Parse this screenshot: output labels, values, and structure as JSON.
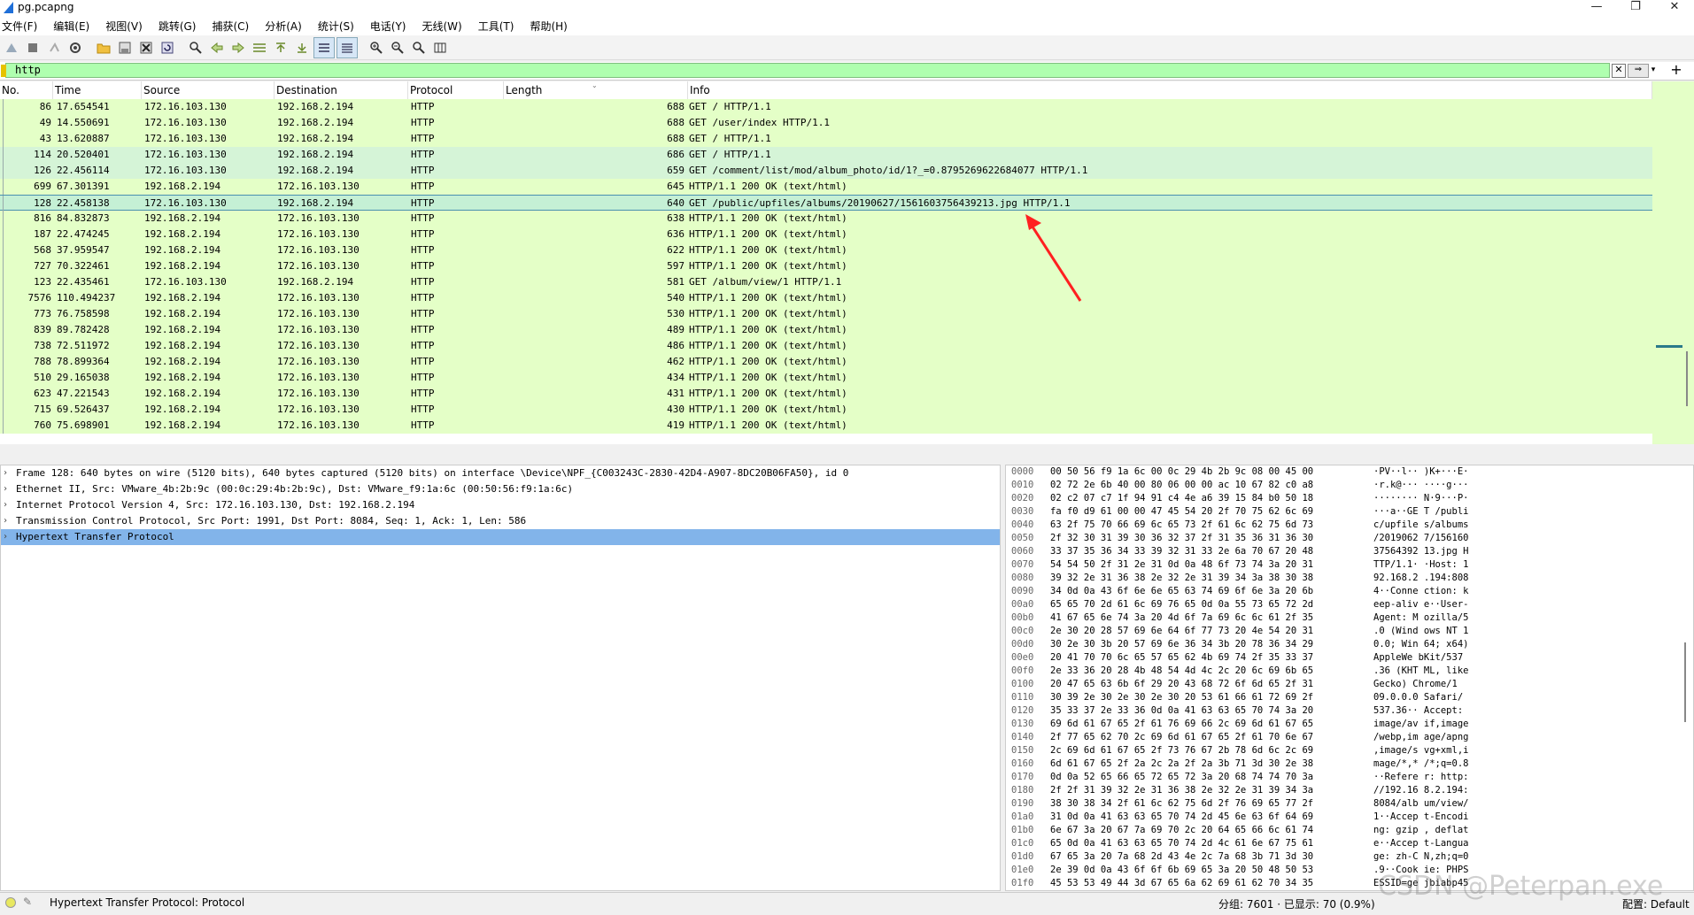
{
  "window": {
    "title": "pg.pcapng",
    "minimize": "—",
    "maximize": "❐",
    "close": "✕"
  },
  "menu": [
    "文件(F)",
    "编辑(E)",
    "视图(V)",
    "跳转(G)",
    "捕获(C)",
    "分析(A)",
    "统计(S)",
    "电话(Y)",
    "无线(W)",
    "工具(T)",
    "帮助(H)"
  ],
  "toolbar": {
    "icons": [
      "start-capture-icon",
      "stop-capture-icon",
      "restart-capture-icon",
      "capture-options-icon",
      "open-file-icon",
      "save-file-icon",
      "close-file-icon",
      "reload-icon",
      "find-packet-icon",
      "go-back-icon",
      "go-forward-icon",
      "go-to-packet-icon",
      "go-first-icon",
      "go-last-icon",
      "autoscroll-icon",
      "colorize-icon",
      "zoom-in-icon",
      "zoom-out-icon",
      "zoom-normal-icon",
      "resize-columns-icon"
    ]
  },
  "filter": {
    "value": "http",
    "clear": "✕",
    "apply": "⇒",
    "dropdown": "▾",
    "add": "+"
  },
  "packet_list": {
    "columns": [
      "No.",
      "Time",
      "Source",
      "Destination",
      "Protocol",
      "Length",
      "Info"
    ],
    "rows": [
      {
        "no": "86",
        "time": "17.654541",
        "src": "172.16.103.130",
        "dst": "192.168.2.194",
        "proto": "HTTP",
        "len": "688",
        "info": "GET / HTTP/1.1"
      },
      {
        "no": "49",
        "time": "14.550691",
        "src": "172.16.103.130",
        "dst": "192.168.2.194",
        "proto": "HTTP",
        "len": "688",
        "info": "GET /user/index HTTP/1.1"
      },
      {
        "no": "43",
        "time": "13.620887",
        "src": "172.16.103.130",
        "dst": "192.168.2.194",
        "proto": "HTTP",
        "len": "688",
        "info": "GET / HTTP/1.1"
      },
      {
        "no": "114",
        "time": "20.520401",
        "src": "172.16.103.130",
        "dst": "192.168.2.194",
        "proto": "HTTP",
        "len": "686",
        "info": "GET / HTTP/1.1"
      },
      {
        "no": "126",
        "time": "22.456114",
        "src": "172.16.103.130",
        "dst": "192.168.2.194",
        "proto": "HTTP",
        "len": "659",
        "info": "GET /comment/list/mod/album_photo/id/1?_=0.8795269622684077 HTTP/1.1"
      },
      {
        "no": "699",
        "time": "67.301391",
        "src": "192.168.2.194",
        "dst": "172.16.103.130",
        "proto": "HTTP",
        "len": "645",
        "info": "HTTP/1.1 200 OK  (text/html)"
      },
      {
        "no": "128",
        "time": "22.458138",
        "src": "172.16.103.130",
        "dst": "192.168.2.194",
        "proto": "HTTP",
        "len": "640",
        "info": "GET /public/upfiles/albums/20190627/1561603756439213.jpg HTTP/1.1"
      },
      {
        "no": "816",
        "time": "84.832873",
        "src": "192.168.2.194",
        "dst": "172.16.103.130",
        "proto": "HTTP",
        "len": "638",
        "info": "HTTP/1.1 200 OK  (text/html)"
      },
      {
        "no": "187",
        "time": "22.474245",
        "src": "192.168.2.194",
        "dst": "172.16.103.130",
        "proto": "HTTP",
        "len": "636",
        "info": "HTTP/1.1 200 OK  (text/html)"
      },
      {
        "no": "568",
        "time": "37.959547",
        "src": "192.168.2.194",
        "dst": "172.16.103.130",
        "proto": "HTTP",
        "len": "622",
        "info": "HTTP/1.1 200 OK  (text/html)"
      },
      {
        "no": "727",
        "time": "70.322461",
        "src": "192.168.2.194",
        "dst": "172.16.103.130",
        "proto": "HTTP",
        "len": "597",
        "info": "HTTP/1.1 200 OK  (text/html)"
      },
      {
        "no": "123",
        "time": "22.435461",
        "src": "172.16.103.130",
        "dst": "192.168.2.194",
        "proto": "HTTP",
        "len": "581",
        "info": "GET /album/view/1 HTTP/1.1"
      },
      {
        "no": "7576",
        "time": "110.494237",
        "src": "192.168.2.194",
        "dst": "172.16.103.130",
        "proto": "HTTP",
        "len": "540",
        "info": "HTTP/1.1 200 OK  (text/html)"
      },
      {
        "no": "773",
        "time": "76.758598",
        "src": "192.168.2.194",
        "dst": "172.16.103.130",
        "proto": "HTTP",
        "len": "530",
        "info": "HTTP/1.1 200 OK  (text/html)"
      },
      {
        "no": "839",
        "time": "89.782428",
        "src": "192.168.2.194",
        "dst": "172.16.103.130",
        "proto": "HTTP",
        "len": "489",
        "info": "HTTP/1.1 200 OK  (text/html)"
      },
      {
        "no": "738",
        "time": "72.511972",
        "src": "192.168.2.194",
        "dst": "172.16.103.130",
        "proto": "HTTP",
        "len": "486",
        "info": "HTTP/1.1 200 OK  (text/html)"
      },
      {
        "no": "788",
        "time": "78.899364",
        "src": "192.168.2.194",
        "dst": "172.16.103.130",
        "proto": "HTTP",
        "len": "462",
        "info": "HTTP/1.1 200 OK  (text/html)"
      },
      {
        "no": "510",
        "time": "29.165038",
        "src": "192.168.2.194",
        "dst": "172.16.103.130",
        "proto": "HTTP",
        "len": "434",
        "info": "HTTP/1.1 200 OK  (text/html)"
      },
      {
        "no": "623",
        "time": "47.221543",
        "src": "192.168.2.194",
        "dst": "172.16.103.130",
        "proto": "HTTP",
        "len": "431",
        "info": "HTTP/1.1 200 OK  (text/html)"
      },
      {
        "no": "715",
        "time": "69.526437",
        "src": "192.168.2.194",
        "dst": "172.16.103.130",
        "proto": "HTTP",
        "len": "430",
        "info": "HTTP/1.1 200 OK  (text/html)"
      },
      {
        "no": "760",
        "time": "75.698901",
        "src": "192.168.2.194",
        "dst": "172.16.103.130",
        "proto": "HTTP",
        "len": "419",
        "info": "HTTP/1.1 200 OK  (text/html)"
      }
    ]
  },
  "details": [
    {
      "text": "Frame 128: 640 bytes on wire (5120 bits), 640 bytes captured (5120 bits) on interface \\Device\\NPF_{C003243C-2830-42D4-A907-8DC20B06FA50}, id 0"
    },
    {
      "text": "Ethernet II, Src: VMware_4b:2b:9c (00:0c:29:4b:2b:9c), Dst: VMware_f9:1a:6c (00:50:56:f9:1a:6c)"
    },
    {
      "text": "Internet Protocol Version 4, Src: 172.16.103.130, Dst: 192.168.2.194"
    },
    {
      "text": "Transmission Control Protocol, Src Port: 1991, Dst Port: 8084, Seq: 1, Ack: 1, Len: 586"
    },
    {
      "text": "Hypertext Transfer Protocol"
    }
  ],
  "bytes": [
    {
      "off": "0000",
      "hex": "00 50 56 f9 1a 6c 00 0c  29 4b 2b 9c 08 00 45 00",
      "asc": "·PV··l·· )K+···E·"
    },
    {
      "off": "0010",
      "hex": "02 72 2e 6b 40 00 80 06  00 00 ac 10 67 82 c0 a8",
      "asc": "·r.k@··· ····g···"
    },
    {
      "off": "0020",
      "hex": "02 c2 07 c7 1f 94 91 c4  4e a6 39 15 84 b0 50 18",
      "asc": "········ N·9···P·"
    },
    {
      "off": "0030",
      "hex": "fa f0 d9 61 00 00 47 45  54 20 2f 70 75 62 6c 69",
      "asc": "···a··GE T /publi"
    },
    {
      "off": "0040",
      "hex": "63 2f 75 70 66 69 6c 65  73 2f 61 6c 62 75 6d 73",
      "asc": "c/upfile s/albums"
    },
    {
      "off": "0050",
      "hex": "2f 32 30 31 39 30 36 32  37 2f 31 35 36 31 36 30",
      "asc": "/2019062 7/156160"
    },
    {
      "off": "0060",
      "hex": "33 37 35 36 34 33 39 32  31 33 2e 6a 70 67 20 48",
      "asc": "37564392 13.jpg H"
    },
    {
      "off": "0070",
      "hex": "54 54 50 2f 31 2e 31 0d  0a 48 6f 73 74 3a 20 31",
      "asc": "TTP/1.1· ·Host: 1"
    },
    {
      "off": "0080",
      "hex": "39 32 2e 31 36 38 2e 32  2e 31 39 34 3a 38 30 38",
      "asc": "92.168.2 .194:808"
    },
    {
      "off": "0090",
      "hex": "34 0d 0a 43 6f 6e 6e 65  63 74 69 6f 6e 3a 20 6b",
      "asc": "4··Conne ction: k"
    },
    {
      "off": "00a0",
      "hex": "65 65 70 2d 61 6c 69 76  65 0d 0a 55 73 65 72 2d",
      "asc": "eep-aliv e··User-"
    },
    {
      "off": "00b0",
      "hex": "41 67 65 6e 74 3a 20 4d  6f 7a 69 6c 6c 61 2f 35",
      "asc": "Agent: M ozilla/5"
    },
    {
      "off": "00c0",
      "hex": "2e 30 20 28 57 69 6e 64  6f 77 73 20 4e 54 20 31",
      "asc": ".0 (Wind ows NT 1"
    },
    {
      "off": "00d0",
      "hex": "30 2e 30 3b 20 57 69 6e  36 34 3b 20 78 36 34 29",
      "asc": "0.0; Win 64; x64)"
    },
    {
      "off": "00e0",
      "hex": "20 41 70 70 6c 65 57 65  62 4b 69 74 2f 35 33 37",
      "asc": " AppleWe bKit/537"
    },
    {
      "off": "00f0",
      "hex": "2e 33 36 20 28 4b 48 54  4d 4c 2c 20 6c 69 6b 65",
      "asc": ".36 (KHT ML, like"
    },
    {
      "off": "0100",
      "hex": "20 47 65 63 6b 6f 29 20  43 68 72 6f 6d 65 2f 31",
      "asc": " Gecko)  Chrome/1"
    },
    {
      "off": "0110",
      "hex": "30 39 2e 30 2e 30 2e 30  20 53 61 66 61 72 69 2f",
      "asc": "09.0.0.0  Safari/"
    },
    {
      "off": "0120",
      "hex": "35 33 37 2e 33 36 0d 0a  41 63 63 65 70 74 3a 20",
      "asc": "537.36·· Accept: "
    },
    {
      "off": "0130",
      "hex": "69 6d 61 67 65 2f 61 76  69 66 2c 69 6d 61 67 65",
      "asc": "image/av if,image"
    },
    {
      "off": "0140",
      "hex": "2f 77 65 62 70 2c 69 6d  61 67 65 2f 61 70 6e 67",
      "asc": "/webp,im age/apng"
    },
    {
      "off": "0150",
      "hex": "2c 69 6d 61 67 65 2f 73  76 67 2b 78 6d 6c 2c 69",
      "asc": ",image/s vg+xml,i"
    },
    {
      "off": "0160",
      "hex": "6d 61 67 65 2f 2a 2c 2a  2f 2a 3b 71 3d 30 2e 38",
      "asc": "mage/*,* /*;q=0.8"
    },
    {
      "off": "0170",
      "hex": "0d 0a 52 65 66 65 72 65  72 3a 20 68 74 74 70 3a",
      "asc": "··Refere r: http:"
    },
    {
      "off": "0180",
      "hex": "2f 2f 31 39 32 2e 31 36  38 2e 32 2e 31 39 34 3a",
      "asc": "//192.16 8.2.194:"
    },
    {
      "off": "0190",
      "hex": "38 30 38 34 2f 61 6c 62  75 6d 2f 76 69 65 77 2f",
      "asc": "8084/alb um/view/"
    },
    {
      "off": "01a0",
      "hex": "31 0d 0a 41 63 63 65 70  74 2d 45 6e 63 6f 64 69",
      "asc": "1··Accep t-Encodi"
    },
    {
      "off": "01b0",
      "hex": "6e 67 3a 20 67 7a 69 70  2c 20 64 65 66 6c 61 74",
      "asc": "ng: gzip , deflat"
    },
    {
      "off": "01c0",
      "hex": "65 0d 0a 41 63 63 65 70  74 2d 4c 61 6e 67 75 61",
      "asc": "e··Accep t-Langua"
    },
    {
      "off": "01d0",
      "hex": "67 65 3a 20 7a 68 2d 43  4e 2c 7a 68 3b 71 3d 30",
      "asc": "ge: zh-C N,zh;q=0"
    },
    {
      "off": "01e0",
      "hex": "2e 39 0d 0a 43 6f 6f 6b  69 65 3a 20 50 48 50 53",
      "asc": ".9··Cook ie: PHPS"
    },
    {
      "off": "01f0",
      "hex": "45 53 53 49 44 3d 67 65  6a 62 69 61 62 70 34 35",
      "asc": "ESSID=ge jbiabp45"
    }
  ],
  "status": {
    "field_info": "Hypertext Transfer Protocol: Protocol",
    "stats": "分组: 7601 · 已显示: 70 (0.9%)",
    "profile": "配置: Default"
  },
  "watermark": "CSDN @Peterpan.exe",
  "colors": {
    "row_http": "#e4ffc7",
    "row_selected_border": "#4a8fb0",
    "detail_selected": "#82b4ea",
    "filter_valid": "#afffaf",
    "annotation_arrow": "#ff2020"
  }
}
